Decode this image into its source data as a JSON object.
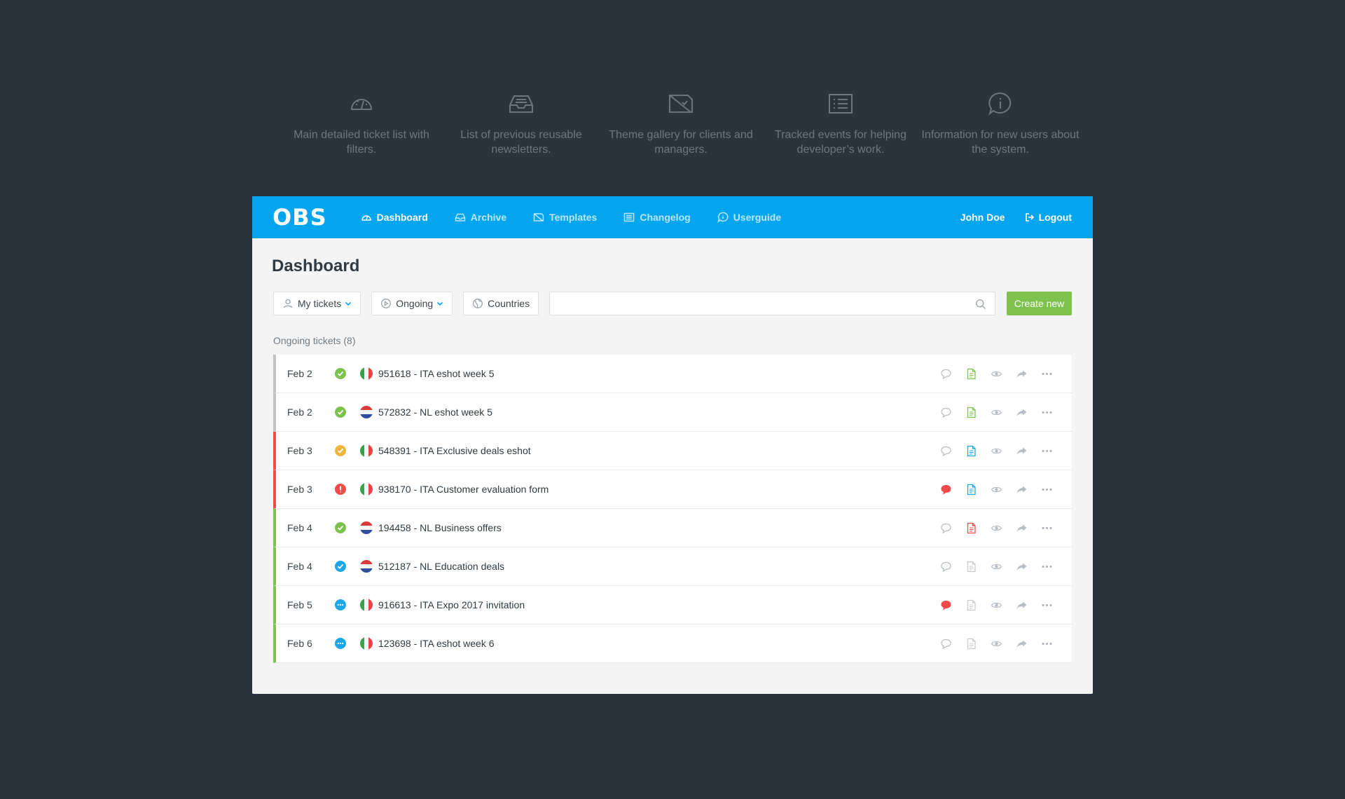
{
  "features": [
    {
      "icon": "speedometer-icon",
      "text": "Main detailed ticket list with filters."
    },
    {
      "icon": "inbox-icon",
      "text": "List of previous reusable newsletters."
    },
    {
      "icon": "image-gallery-icon",
      "text": "Theme gallery for clients and managers."
    },
    {
      "icon": "list-icon",
      "text": "Tracked events for helping developer’s work."
    },
    {
      "icon": "info-bubble-icon",
      "text": "Information for new users about the system."
    }
  ],
  "topbar": {
    "logo": "OBS",
    "nav": [
      {
        "label": "Dashboard",
        "icon": "speedometer-icon",
        "active": true
      },
      {
        "label": "Archive",
        "icon": "inbox-icon",
        "active": false
      },
      {
        "label": "Templates",
        "icon": "image-gallery-icon",
        "active": false
      },
      {
        "label": "Changelog",
        "icon": "list-icon",
        "active": false
      },
      {
        "label": "Userguide",
        "icon": "info-bubble-icon",
        "active": false
      }
    ],
    "user": "John Doe",
    "logout": "Logout"
  },
  "page": {
    "title": "Dashboard"
  },
  "filters": {
    "my_tickets": "My tickets",
    "ongoing": "Ongoing",
    "countries": "Countries",
    "search_value": "",
    "create_new": "Create new"
  },
  "list": {
    "heading": "Ongoing tickets (8)",
    "rows": [
      {
        "date": "Feb 2",
        "status": "done",
        "flag": "ita",
        "name": "951618 -  ITA eshot week 5",
        "bar": "#bfc3c6",
        "comment": "empty",
        "doc": "#7dc24d"
      },
      {
        "date": "Feb 2",
        "status": "done",
        "flag": "nl",
        "name": "572832 - NL eshot week 5",
        "bar": "#bfc3c6",
        "comment": "empty",
        "doc": "#7dc24d"
      },
      {
        "date": "Feb 3",
        "status": "pending",
        "flag": "ita",
        "name": "548391 - ITA Exclusive deals eshot",
        "bar": "#ef4b4b",
        "comment": "empty",
        "doc": "#1ea7e6"
      },
      {
        "date": "Feb 3",
        "status": "alert",
        "flag": "ita",
        "name": "938170 - ITA Customer evaluation form",
        "bar": "#ef4b4b",
        "comment": "filled",
        "doc": "#1ea7e6"
      },
      {
        "date": "Feb 4",
        "status": "done",
        "flag": "nl",
        "name": "194458 - NL Business offers",
        "bar": "#7dc24d",
        "comment": "empty",
        "doc": "#ef4b4b"
      },
      {
        "date": "Feb 4",
        "status": "approved",
        "flag": "nl",
        "name": "512187 - NL Education deals",
        "bar": "#7dc24d",
        "comment": "empty",
        "doc": "#c8ccd0"
      },
      {
        "date": "Feb 5",
        "status": "progress",
        "flag": "ita",
        "name": "916613 - ITA Expo 2017 invitation",
        "bar": "#7dc24d",
        "comment": "filled",
        "doc": "#c8ccd0"
      },
      {
        "date": "Feb 6",
        "status": "progress",
        "flag": "ita",
        "name": "123698 - ITA eshot week 6",
        "bar": "#7dc24d",
        "comment": "empty",
        "doc": "#c8ccd0"
      }
    ]
  },
  "colors": {
    "accent": "#04a5ef",
    "success": "#7dc24d",
    "danger": "#ef4b4b",
    "warning": "#f0b43c",
    "background": "#2b343c"
  }
}
